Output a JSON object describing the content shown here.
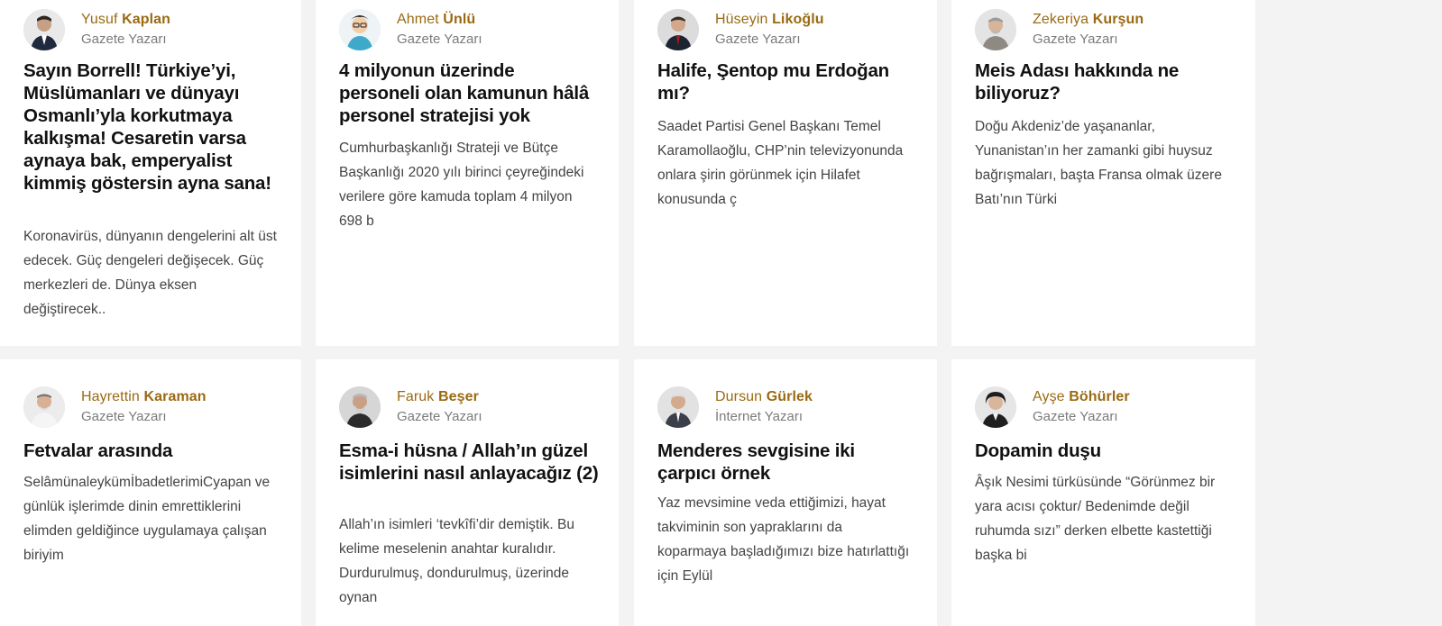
{
  "cards": [
    {
      "author_first": "Yusuf",
      "author_last": "Kaplan",
      "role": "Gazete Yazarı",
      "avatar_icon": "author-photo",
      "title": "Sayın Borrell! Türkiye’yi, Müslümanları ve dünyayı Osmanlı’yla korkutmaya kalkışma! Cesaretin varsa aynaya bak, emperyalist kimmiş göstersin ayna sana!",
      "excerpt": "Koronavirüs, dünyanın dengelerini alt üst edecek. Güç dengeleri değişecek. Güç merkezleri de. Dünya eksen değiştirecek.."
    },
    {
      "author_first": "Ahmet",
      "author_last": "Ünlü",
      "role": "Gazete Yazarı",
      "avatar_icon": "author-illustration",
      "title": "4 milyonun üzerinde personeli olan kamunun hâlâ personel stratejisi yok",
      "excerpt": "Cumhurbaşkanlığı Strateji ve Bütçe Başkanlığı 2020 yılı birinci çeyreğindeki verilere göre kamuda toplam 4 milyon 698 b"
    },
    {
      "author_first": "Hüseyin",
      "author_last": "Likoğlu",
      "role": "Gazete Yazarı",
      "avatar_icon": "author-photo",
      "title": "Halife, Şentop mu Erdoğan mı?",
      "excerpt": "Saadet Partisi Genel Başkanı Temel Karamollaoğlu, CHP’nin televizyonunda onlara şirin görünmek için Hilafet konusunda ç"
    },
    {
      "author_first": "Zekeriya",
      "author_last": "Kurşun",
      "role": "Gazete Yazarı",
      "avatar_icon": "author-photo",
      "title": "Meis Adası hakkında ne biliyoruz?",
      "excerpt": "Doğu Akdeniz’de yaşananlar, Yunanistan’ın her zamanki gibi huysuz bağrışmaları, başta Fransa olmak üzere Batı’nın Türki"
    },
    {
      "author_first": "Hayrettin",
      "author_last": "Karaman",
      "role": "Gazete Yazarı",
      "avatar_icon": "author-photo",
      "title": "Fetvalar arasında",
      "excerpt": "SelâmünaleykümİbadetlerimiCyapan ve günlük işlerimde dinin emrettiklerini elimden geldiğince uygulamaya çalışan biriyim"
    },
    {
      "author_first": "Faruk",
      "author_last": "Beşer",
      "role": "Gazete Yazarı",
      "avatar_icon": "author-photo",
      "title": "Esma-i hüsna / Allah’ın güzel isimlerini nasıl anlayacağız (2)",
      "excerpt": "Allah’ın isimleri ‘tevkîfi’dir demiştik. Bu kelime meselenin anahtar kuralıdır. Durdurulmuş, dondurulmuş, üzerinde oynan"
    },
    {
      "author_first": "Dursun",
      "author_last": "Gürlek",
      "role": "İnternet Yazarı",
      "avatar_icon": "author-photo",
      "title": "Menderes sevgisine iki çarpıcı örnek",
      "excerpt": "Yaz mevsimine veda ettiğimizi, hayat takviminin son yapraklarını da koparmaya başladığımızı bize hatırlattığı için Eylül"
    },
    {
      "author_first": "Ayşe",
      "author_last": "Böhürler",
      "role": "Gazete Yazarı",
      "avatar_icon": "author-photo",
      "title": "Dopamin duşu",
      "excerpt": "Âşık Nesimi türküsünde “Görünmez bir yara acısı çoktur/ Bedenimde değil ruhumda sızı” derken elbette kastettiği başka bi"
    }
  ]
}
